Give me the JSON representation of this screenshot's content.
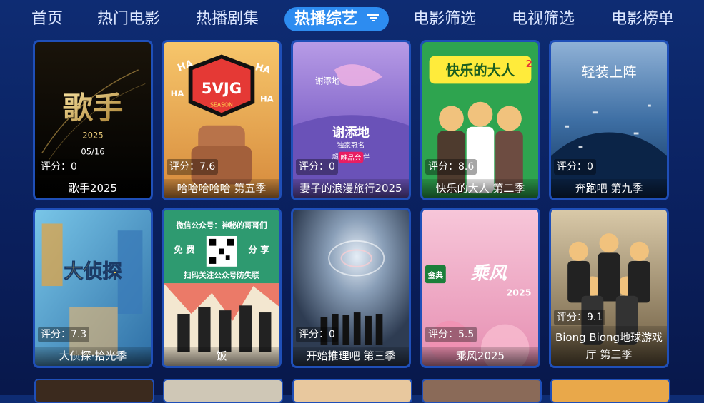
{
  "nav": {
    "tabs": [
      {
        "label": "首页"
      },
      {
        "label": "热门电影"
      },
      {
        "label": "热播剧集"
      },
      {
        "label": "热播综艺",
        "active": true
      },
      {
        "label": "电影筛选"
      },
      {
        "label": "电视筛选"
      },
      {
        "label": "电影榜单"
      }
    ]
  },
  "cards": [
    {
      "score_label": "评分：0",
      "title": "歌手2025",
      "poster_text": [
        "歌手",
        "2025",
        "05/16"
      ]
    },
    {
      "score_label": "评分：7.6",
      "title": "哈哈哈哈哈 第五季",
      "poster_text": [
        "5VJG",
        "SEASON",
        "HA"
      ]
    },
    {
      "score_label": "评分：0",
      "title": "妻子的浪漫旅行2025",
      "poster_text": [
        "谢添地",
        "独家冠名",
        "谢添地",
        "超级合作伙伴",
        "唯品会"
      ]
    },
    {
      "score_label": "评分：8.6",
      "title": "快乐的大人 第二季",
      "poster_text": [
        "快乐的大人",
        "2"
      ]
    },
    {
      "score_label": "评分：0",
      "title": "奔跑吧 第九季",
      "poster_text": [
        "轻装上阵"
      ]
    },
    {
      "score_label": "评分：7.3",
      "title": "大侦探·拾光季",
      "poster_text": [
        "大侦探"
      ]
    },
    {
      "score_label": "",
      "title": "饭",
      "poster_text": [
        "微信公众号：神秘的哥哥们",
        "免 费",
        "分 享",
        "扫码关注公众号防失联"
      ]
    },
    {
      "score_label": "评分：0",
      "title": "开始推理吧 第三季",
      "poster_text": []
    },
    {
      "score_label": "评分：5.5",
      "title": "乘风2025",
      "poster_text": [
        "乘风",
        "2025",
        "金典"
      ]
    },
    {
      "score_label": "评分：9.1",
      "title": "Biong Biong地球游戏厅 第三季",
      "poster_text": []
    }
  ]
}
